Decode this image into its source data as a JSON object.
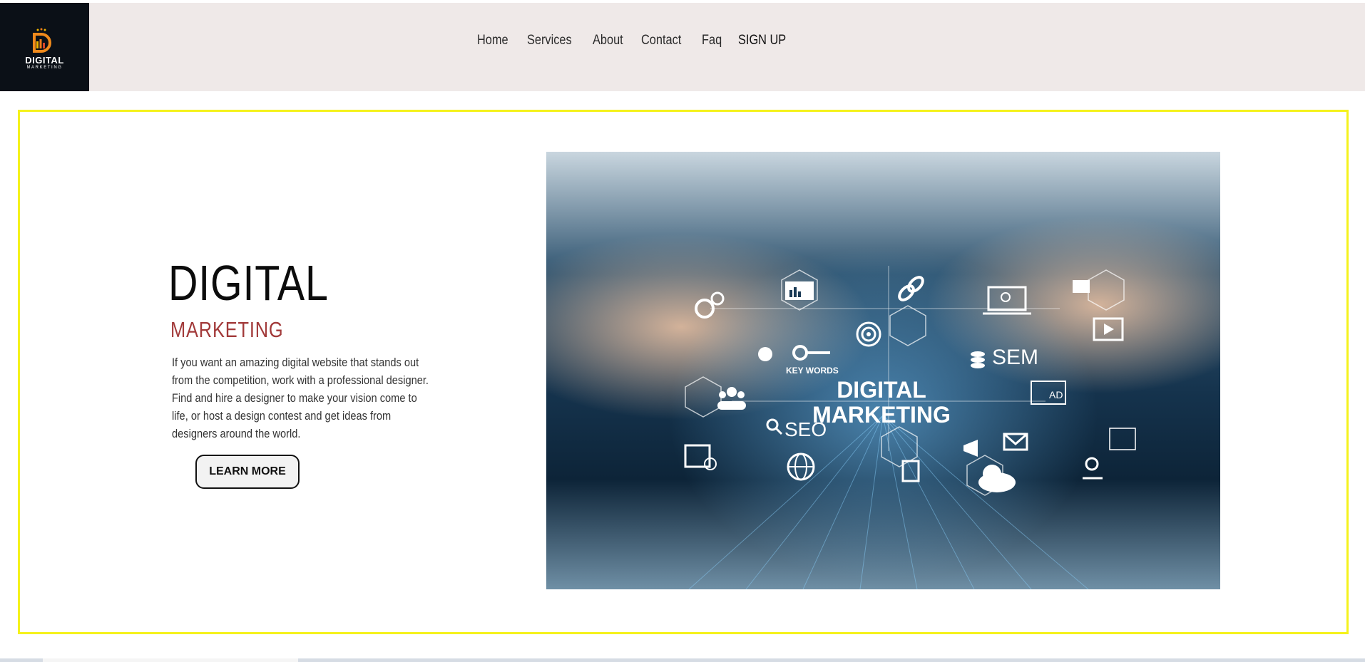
{
  "header": {
    "logo": {
      "line1": "DIGITAL",
      "line2": "MARKETING",
      "background": "#0b1017",
      "icon": "d-bar-chart-logo-icon"
    },
    "nav": [
      {
        "label": "Home"
      },
      {
        "label": "Services"
      },
      {
        "label": "About"
      },
      {
        "label": "Contact"
      },
      {
        "label": "Faq"
      },
      {
        "label": "SIGN UP"
      }
    ],
    "background": "#efe9e8"
  },
  "hero": {
    "title": "DIGITAL",
    "subtitle": "MARKETING",
    "description": "If you want an amazing digital website that stands out from the competition, work with a professional designer. Find and hire a designer to make your vision come to life, or host a design contest and get ideas from designers around the world.",
    "button_label": "LEARN MORE",
    "border_color": "#f5f21c",
    "subtitle_color": "#a23a3a",
    "image": {
      "labels": {
        "main_line1": "DIGITAL",
        "main_line2": "MARKETING",
        "seo": "SEO",
        "sem": "SEM",
        "keywords": "KEY WORDS",
        "ad": "AD"
      },
      "icons": [
        "gears-icon",
        "analytics-monitor-icon",
        "link-icon",
        "laptop-search-icon",
        "image-icon",
        "play-icon",
        "bulb-icon",
        "key-icon",
        "target-icon",
        "coins-icon",
        "team-icon",
        "ad-icon",
        "search-icon",
        "megaphone-icon",
        "mail-icon",
        "checklist-icon",
        "calendar-icon",
        "globe-icon",
        "document-icon",
        "cloud-icon",
        "location-pin-icon"
      ]
    }
  }
}
